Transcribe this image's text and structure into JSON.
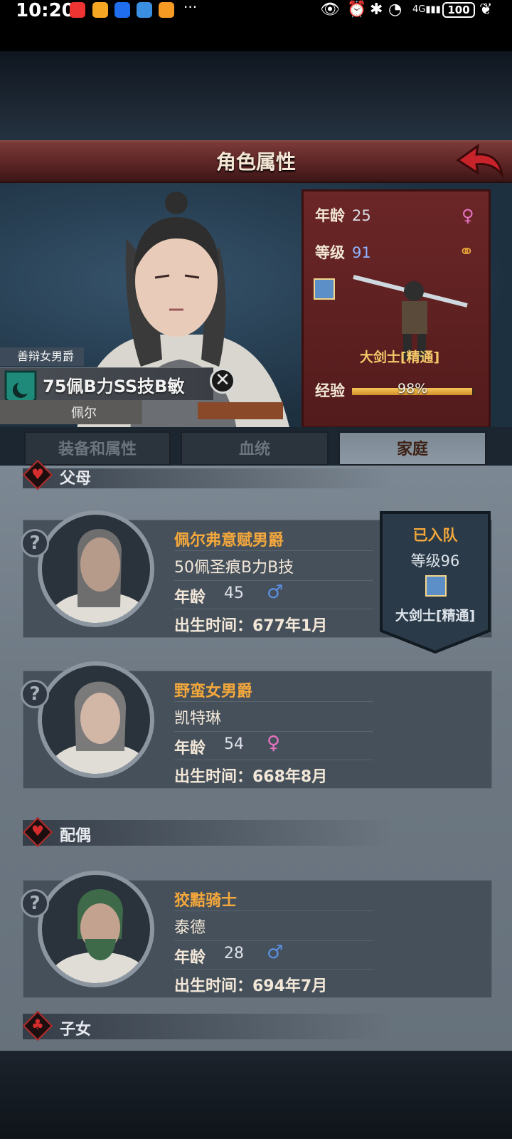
{
  "status_bar": {
    "time": "10:20",
    "dots": "···",
    "battery": "100",
    "network": "4G"
  },
  "header": {
    "title": "角色属性"
  },
  "character": {
    "title_tag": "善辩女男爵",
    "summary": "75佩B力SS技B敏",
    "name": "佩尔",
    "age_label": "年龄",
    "age": "25",
    "level_label": "等级",
    "level": "91",
    "class": "大剑士[精通]",
    "exp_label": "经验",
    "exp_percent_text": "98%",
    "exp_fraction": 0.98
  },
  "tabs": [
    {
      "label": "装备和属性",
      "active": false
    },
    {
      "label": "血统",
      "active": false
    },
    {
      "label": "家庭",
      "active": true
    }
  ],
  "sections": {
    "parents": "父母",
    "spouse": "配偶",
    "children": "子女"
  },
  "family": [
    {
      "title": "佩尔弗意赋男爵",
      "name": "50佩圣痕B力B技",
      "age_label": "年龄",
      "age": "45",
      "gender": "male",
      "birth": "出生时间：677年1月"
    },
    {
      "title": "野蛮女男爵",
      "name": "凯特琳",
      "age_label": "年龄",
      "age": "54",
      "gender": "female",
      "birth": "出生时间：668年8月"
    },
    {
      "title": "狡黠骑士",
      "name": "泰德",
      "age_label": "年龄",
      "age": "28",
      "gender": "male",
      "birth": "出生时间：694年7月"
    }
  ],
  "team_banner": {
    "status": "已入队",
    "level": "等级96",
    "class": "大剑士[精通]"
  },
  "icons": {
    "help": "?",
    "close": "✕",
    "male": "♂",
    "female": "♀",
    "heart": "♥"
  },
  "colors": {
    "accent_orange": "#f4a83c",
    "header_red": "#5a2324",
    "panel_gray": "#6d7883"
  }
}
